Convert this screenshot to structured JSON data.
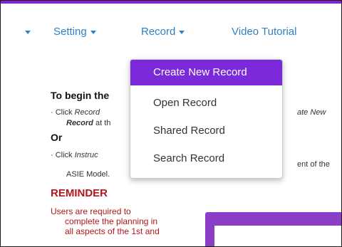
{
  "nav": {
    "items": [
      {
        "label": "Setting"
      },
      {
        "label": "Record"
      },
      {
        "label": "Video Tutorial"
      }
    ]
  },
  "dropdown": {
    "items": [
      {
        "label": "Create New Record",
        "active": true
      },
      {
        "label": "Open Record"
      },
      {
        "label": "Shared Record"
      },
      {
        "label": "Search Record"
      }
    ]
  },
  "content": {
    "heading_begin": "To begin the",
    "line1_prefix": "· Click ",
    "line1_link": "Record",
    "line1_right": "ate New",
    "line2_bold": "Record",
    "line2_rest": " at th",
    "or": "Or",
    "line3_prefix": "· Click ",
    "line3_link": "Instruc",
    "line3_right": "ent of the",
    "line4": "ASIE Model.",
    "reminder_title": "REMINDER",
    "reminder_lines": [
      "Users are required to",
      "complete the planning in",
      "all aspects of the 1st and"
    ]
  },
  "colors": {
    "accent_purple": "#8a1fd8",
    "menu_active": "#7b2ad9",
    "nav_blue": "#2f7fc4",
    "reminder_red": "#b0161b"
  }
}
